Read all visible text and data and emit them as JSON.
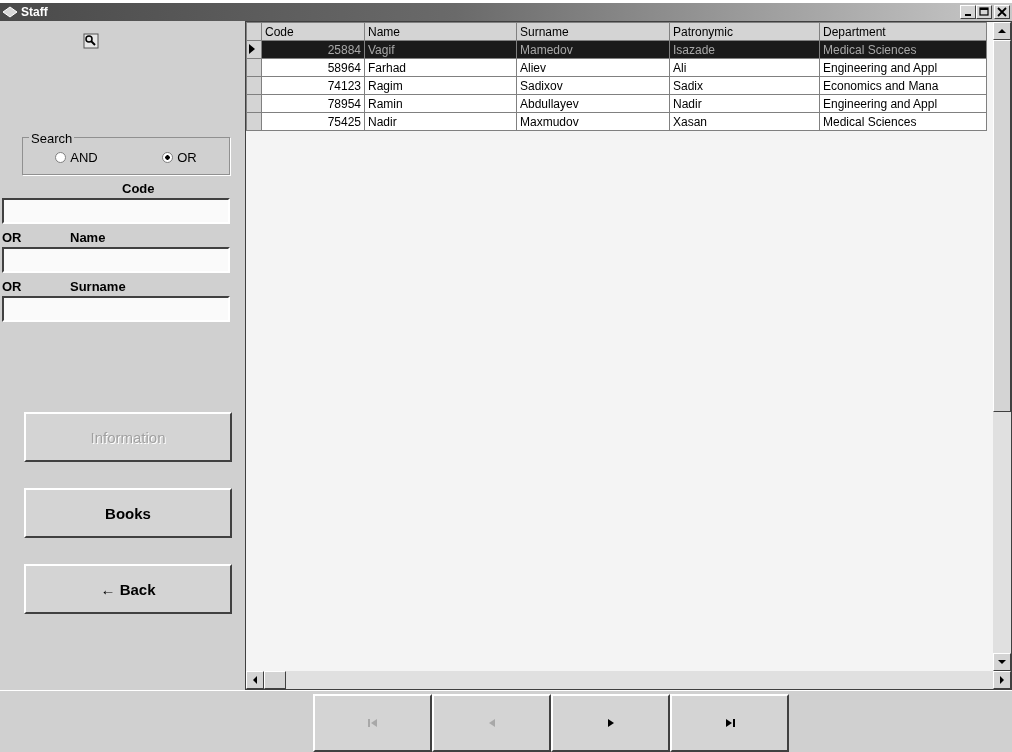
{
  "window": {
    "title": "Staff"
  },
  "search": {
    "legend": "Search",
    "options": [
      {
        "label": "AND",
        "selected": false
      },
      {
        "label": "OR",
        "selected": true
      }
    ]
  },
  "fields": [
    {
      "label": "Code"
    },
    {
      "prefix": "OR",
      "label": "Name"
    },
    {
      "prefix": "OR",
      "label": "Surname"
    }
  ],
  "buttons": [
    {
      "label": "Information",
      "disabled": true
    },
    {
      "label": "Books",
      "disabled": false
    },
    {
      "label": "← Back",
      "disabled": false
    }
  ],
  "table": {
    "columns": [
      "Code",
      "Name",
      "Surname",
      "Patronymic",
      "Department"
    ],
    "rows": [
      {
        "selected": true,
        "cells": [
          "25884",
          "Vagif",
          "Mamedov",
          "Isazade",
          "Medical Sciences"
        ]
      },
      {
        "selected": false,
        "cells": [
          "58964",
          "Farhad",
          "Aliev",
          "Ali",
          "Engineering and Appl"
        ]
      },
      {
        "selected": false,
        "cells": [
          "74123",
          "Ragim",
          "Sadixov",
          "Sadix",
          "Economics and Mana"
        ]
      },
      {
        "selected": false,
        "cells": [
          "78954",
          "Ramin",
          "Abdullayev",
          "Nadir",
          "Engineering and Appl"
        ]
      },
      {
        "selected": false,
        "cells": [
          "75425",
          "Nadir",
          "Maxmudov",
          "Xasan",
          "Medical Sciences"
        ]
      }
    ]
  },
  "navigator": [
    {
      "kind": "first",
      "disabled": true
    },
    {
      "kind": "prior",
      "disabled": true
    },
    {
      "kind": "next",
      "disabled": false
    },
    {
      "kind": "last",
      "disabled": false
    }
  ]
}
